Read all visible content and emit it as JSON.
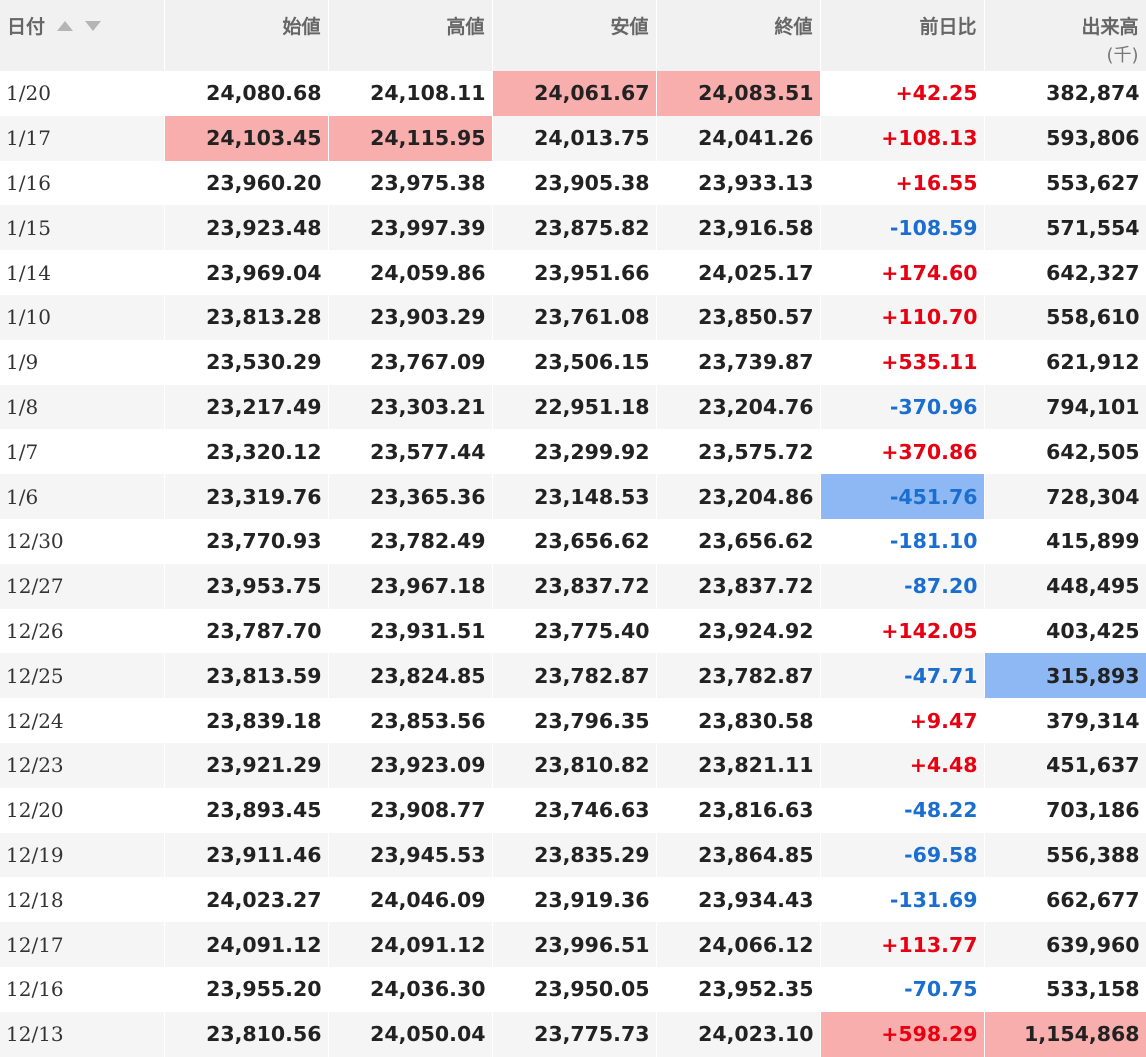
{
  "colors": {
    "positive": "#e60012",
    "negative": "#1a6ed0",
    "highlight_red": "#f9aeae",
    "highlight_blue": "#8db8f4",
    "header_bg": "#f1f1f1",
    "row_alt_bg": "#f5f5f5"
  },
  "header": {
    "date": "日付",
    "sort_up_icon": "triangle-up",
    "sort_down_icon": "triangle-down",
    "open": "始値",
    "high": "高値",
    "low": "安値",
    "close": "終値",
    "change": "前日比",
    "volume": "出来高",
    "volume_unit": "(千)"
  },
  "rows": [
    {
      "date": "1/20",
      "open": "24,080.68",
      "high": "24,108.11",
      "low": "24,061.67",
      "close": "24,083.51",
      "change": "+42.25",
      "volume": "382,874",
      "hl": {
        "low": "red",
        "close": "red"
      }
    },
    {
      "date": "1/17",
      "open": "24,103.45",
      "high": "24,115.95",
      "low": "24,013.75",
      "close": "24,041.26",
      "change": "+108.13",
      "volume": "593,806",
      "hl": {
        "open": "red",
        "high": "red"
      }
    },
    {
      "date": "1/16",
      "open": "23,960.20",
      "high": "23,975.38",
      "low": "23,905.38",
      "close": "23,933.13",
      "change": "+16.55",
      "volume": "553,627"
    },
    {
      "date": "1/15",
      "open": "23,923.48",
      "high": "23,997.39",
      "low": "23,875.82",
      "close": "23,916.58",
      "change": "-108.59",
      "volume": "571,554"
    },
    {
      "date": "1/14",
      "open": "23,969.04",
      "high": "24,059.86",
      "low": "23,951.66",
      "close": "24,025.17",
      "change": "+174.60",
      "volume": "642,327"
    },
    {
      "date": "1/10",
      "open": "23,813.28",
      "high": "23,903.29",
      "low": "23,761.08",
      "close": "23,850.57",
      "change": "+110.70",
      "volume": "558,610"
    },
    {
      "date": "1/9",
      "open": "23,530.29",
      "high": "23,767.09",
      "low": "23,506.15",
      "close": "23,739.87",
      "change": "+535.11",
      "volume": "621,912"
    },
    {
      "date": "1/8",
      "open": "23,217.49",
      "high": "23,303.21",
      "low": "22,951.18",
      "close": "23,204.76",
      "change": "-370.96",
      "volume": "794,101"
    },
    {
      "date": "1/7",
      "open": "23,320.12",
      "high": "23,577.44",
      "low": "23,299.92",
      "close": "23,575.72",
      "change": "+370.86",
      "volume": "642,505"
    },
    {
      "date": "1/6",
      "open": "23,319.76",
      "high": "23,365.36",
      "low": "23,148.53",
      "close": "23,204.86",
      "change": "-451.76",
      "volume": "728,304",
      "hl": {
        "change": "blue"
      }
    },
    {
      "date": "12/30",
      "open": "23,770.93",
      "high": "23,782.49",
      "low": "23,656.62",
      "close": "23,656.62",
      "change": "-181.10",
      "volume": "415,899"
    },
    {
      "date": "12/27",
      "open": "23,953.75",
      "high": "23,967.18",
      "low": "23,837.72",
      "close": "23,837.72",
      "change": "-87.20",
      "volume": "448,495"
    },
    {
      "date": "12/26",
      "open": "23,787.70",
      "high": "23,931.51",
      "low": "23,775.40",
      "close": "23,924.92",
      "change": "+142.05",
      "volume": "403,425"
    },
    {
      "date": "12/25",
      "open": "23,813.59",
      "high": "23,824.85",
      "low": "23,782.87",
      "close": "23,782.87",
      "change": "-47.71",
      "volume": "315,893",
      "hl": {
        "volume": "blue"
      }
    },
    {
      "date": "12/24",
      "open": "23,839.18",
      "high": "23,853.56",
      "low": "23,796.35",
      "close": "23,830.58",
      "change": "+9.47",
      "volume": "379,314"
    },
    {
      "date": "12/23",
      "open": "23,921.29",
      "high": "23,923.09",
      "low": "23,810.82",
      "close": "23,821.11",
      "change": "+4.48",
      "volume": "451,637"
    },
    {
      "date": "12/20",
      "open": "23,893.45",
      "high": "23,908.77",
      "low": "23,746.63",
      "close": "23,816.63",
      "change": "-48.22",
      "volume": "703,186"
    },
    {
      "date": "12/19",
      "open": "23,911.46",
      "high": "23,945.53",
      "low": "23,835.29",
      "close": "23,864.85",
      "change": "-69.58",
      "volume": "556,388"
    },
    {
      "date": "12/18",
      "open": "24,023.27",
      "high": "24,046.09",
      "low": "23,919.36",
      "close": "23,934.43",
      "change": "-131.69",
      "volume": "662,677"
    },
    {
      "date": "12/17",
      "open": "24,091.12",
      "high": "24,091.12",
      "low": "23,996.51",
      "close": "24,066.12",
      "change": "+113.77",
      "volume": "639,960"
    },
    {
      "date": "12/16",
      "open": "23,955.20",
      "high": "24,036.30",
      "low": "23,950.05",
      "close": "23,952.35",
      "change": "-70.75",
      "volume": "533,158"
    },
    {
      "date": "12/13",
      "open": "23,810.56",
      "high": "24,050.04",
      "low": "23,775.73",
      "close": "24,023.10",
      "change": "+598.29",
      "volume": "1,154,868",
      "hl": {
        "change": "red",
        "volume": "red"
      }
    }
  ]
}
